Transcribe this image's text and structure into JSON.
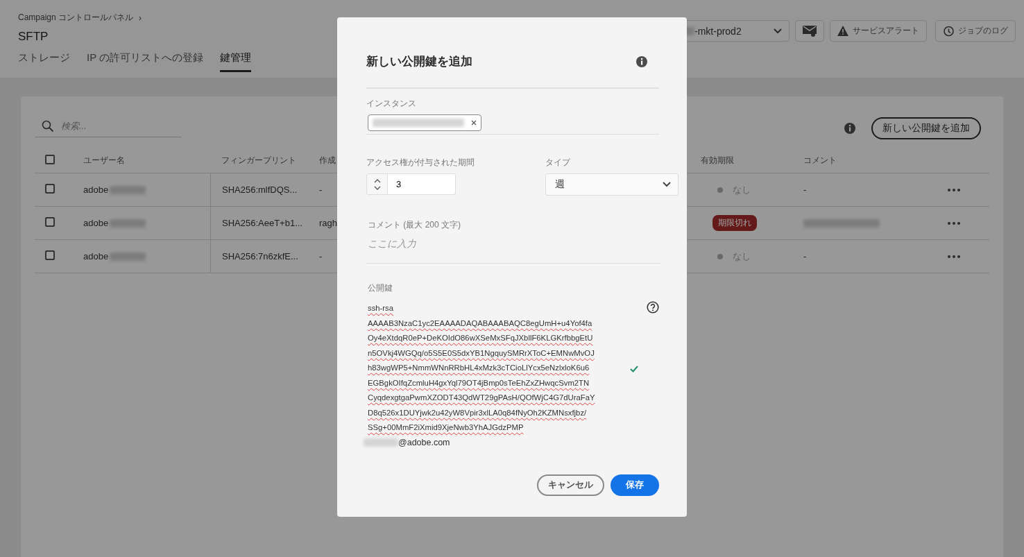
{
  "breadcrumb": {
    "label": "Campaign コントロールパネル",
    "separator": "›"
  },
  "page_title": "SFTP",
  "tabs": [
    {
      "label": "ストレージ",
      "selected": false
    },
    {
      "label": "IP の許可リストへの登録",
      "selected": false
    },
    {
      "label": "鍵管理",
      "selected": true
    }
  ],
  "header_actions": {
    "environment": "-mkt-prod2",
    "service_alert": "サービスアラート",
    "job_log": "ジョブのログ"
  },
  "search": {
    "placeholder": "検索..."
  },
  "add_key_button": "新しい公開鍵を追加",
  "table": {
    "select_all_checked": false,
    "columns": [
      "ユーザー名",
      "フィンガープリント",
      "作成",
      "有効期限",
      "コメント"
    ],
    "rows": [
      {
        "checked": false,
        "username": "adobe",
        "fingerprint": "SHA256:mlfDQS...",
        "creator": "-",
        "expiry": {
          "kind": "none",
          "label": "なし"
        },
        "comment": {
          "kind": "text",
          "text": "-"
        }
      },
      {
        "checked": false,
        "username": "adobe",
        "fingerprint": "SHA256:AeeT+b1...",
        "creator": "ragh",
        "expiry": {
          "kind": "expired",
          "label": "期限切れ"
        },
        "comment": {
          "kind": "blurred"
        }
      },
      {
        "checked": false,
        "username": "adobe",
        "fingerprint": "SHA256:7n6zkfE...",
        "creator": "-",
        "expiry": {
          "kind": "none",
          "label": "なし"
        },
        "comment": {
          "kind": "text",
          "text": "-"
        }
      }
    ]
  },
  "dialog": {
    "title": "新しい公開鍵を追加",
    "instance": {
      "label": "インスタンス"
    },
    "duration": {
      "label": "アクセス権が付与された期間",
      "value": "3"
    },
    "type": {
      "label": "タイプ",
      "value": "週"
    },
    "comment": {
      "label": "コメント (最大 200 文字)",
      "placeholder": "ここに入力"
    },
    "public_key": {
      "label": "公開鍵",
      "value": "ssh-rsa\nAAAAB3NzaC1yc2EAAAADAQABAAABAQC8egUmH+u4Yof4fa\nOy4eXtdqR0eP+DeKOIdO86wXSeMxSFqJXbllF6KLGKrfbbgEtU\nn5OVkj4WGQq/o5S5E0S5dxYB1NgquySMRrXToC+EMNwMvOJ\nh83wgWP5+NmmWNnRRbHL4xMzk3cTCioLlYcx5eNzlxloK6u6\nEGBgkOIfqZcmluH4gxYql79OT4jBmp0sTeEhZxZHwqcSvm2TN\nCyqdexgtgaPwmXZODT43QdWT29gPAsH/QOfWjC4G7dUraFaY\nD8q526x1DUYjwk2u42yW8Vpir3xlLA0q84fNyOh2KZMNsxfjbz/\nSSg+00MmF2iXmid9XjeNwb3YhAJGdzPMP",
      "email_suffix": "@adobe.com",
      "valid": true
    },
    "buttons": {
      "cancel": "キャンセル",
      "save": "保存"
    }
  }
}
